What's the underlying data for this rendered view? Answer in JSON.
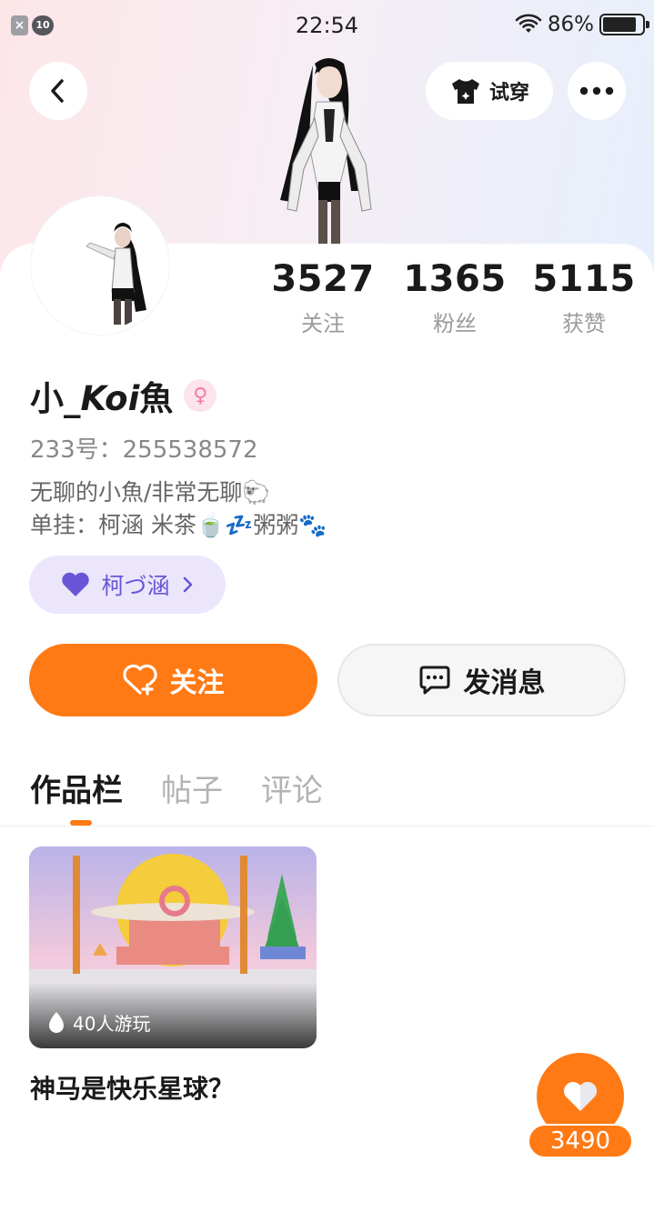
{
  "status_bar": {
    "time": "22:54",
    "battery_text": "86%",
    "battery_level": 0.86,
    "left_badge_1": "×",
    "left_badge_2": "10",
    "icons": [
      "notification-x-icon",
      "notification-10-icon",
      "wifi-icon",
      "battery-icon"
    ]
  },
  "header": {
    "back_icon": "chevron-left-icon",
    "tryon_label": "试穿",
    "tryon_icon": "tshirt-icon",
    "more_icon": "more-dots-icon"
  },
  "profile": {
    "name_prefix": "小_",
    "name_italic": "Koi",
    "name_suffix": "魚",
    "gender_symbol": "♀",
    "uid": "233号：255538572",
    "bio_line1": "无聊的小魚/非常无聊🐑",
    "bio_line2": "单挂：柯涵 米茶🍵💤粥粥🐾",
    "fan_badge_label": "柯づ涵"
  },
  "stats": [
    {
      "value": "3527",
      "label": "关注"
    },
    {
      "value": "1365",
      "label": "粉丝"
    },
    {
      "value": "5115",
      "label": "获赞"
    }
  ],
  "actions": {
    "follow_label": "关注",
    "message_label": "发消息"
  },
  "tabs": [
    {
      "label": "作品栏",
      "active": true
    },
    {
      "label": "帖子",
      "active": false
    },
    {
      "label": "评论",
      "active": false
    }
  ],
  "works": [
    {
      "title": "神马是快乐星球？",
      "play_count": "40人游玩"
    }
  ],
  "like_fab": {
    "count": "3490"
  },
  "colors": {
    "accent": "#ff7a14",
    "badge_bg": "#ebe6fb",
    "badge_fg": "#6a55d6",
    "gender": "#f27aa0"
  }
}
